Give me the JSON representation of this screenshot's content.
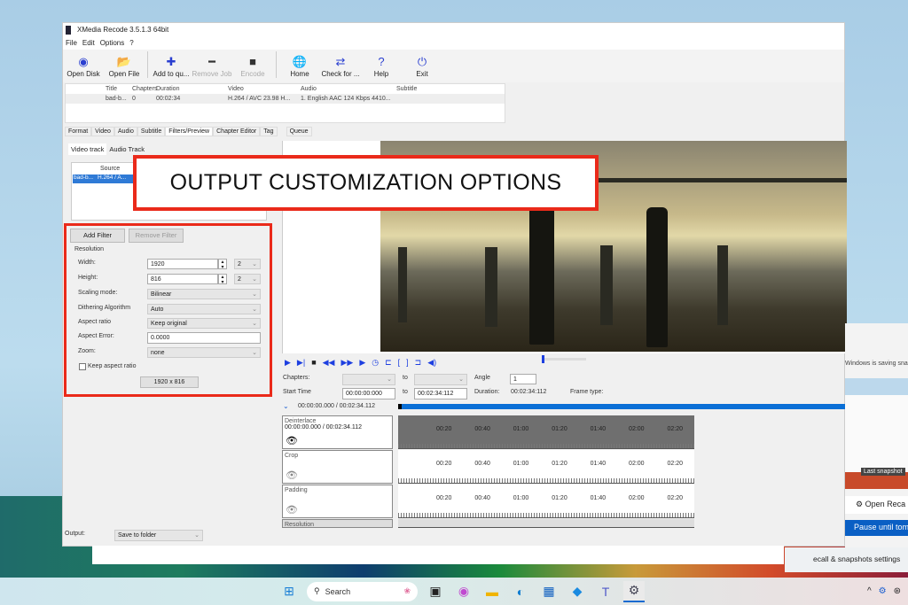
{
  "window": {
    "title": "XMedia Recode 3.5.1.3 64bit",
    "menu": [
      "File",
      "Edit",
      "Options",
      "?"
    ]
  },
  "toolbar": [
    {
      "label": "Open Disk",
      "icon": "disc-icon",
      "glyph": "◉",
      "enabled": true
    },
    {
      "label": "Open File",
      "icon": "folder-icon",
      "glyph": "📂",
      "enabled": true
    },
    {
      "label": "Add to qu...",
      "icon": "plus-icon",
      "glyph": "✚",
      "enabled": true
    },
    {
      "label": "Remove Job",
      "icon": "minus-icon",
      "glyph": "━",
      "enabled": false
    },
    {
      "label": "Encode",
      "icon": "encode-icon",
      "glyph": "■",
      "enabled": false
    },
    {
      "label": "Home",
      "icon": "globe-icon",
      "glyph": "🌐",
      "enabled": true
    },
    {
      "label": "Check for ...",
      "icon": "refresh-icon",
      "glyph": "⇄",
      "enabled": true
    },
    {
      "label": "Help",
      "icon": "help-icon",
      "glyph": "?",
      "enabled": true
    },
    {
      "label": "Exit",
      "icon": "power-icon",
      "glyph": "⏻",
      "enabled": true
    }
  ],
  "jobs": {
    "columns": [
      "Title",
      "Chapters",
      "Duration",
      "Video",
      "Audio",
      "Subtitle"
    ],
    "rows": [
      [
        "bad-b...",
        "0",
        "00:02:34",
        "H.264 / AVC  23.98 H...",
        "1. English AAC  124 Kbps 4410...",
        ""
      ]
    ]
  },
  "tabs": [
    "Format",
    "Video",
    "Audio",
    "Subtitle",
    "Filters/Preview",
    "Chapter Editor",
    "Tag",
    "Queue"
  ],
  "active_tab": "Filters/Preview",
  "subtabs": [
    "Video track",
    "Audio Track"
  ],
  "source_list": {
    "column": "Source",
    "row": [
      "bad-b...",
      "H.264 / A..."
    ]
  },
  "filter_buttons": {
    "add": "Add Filter",
    "remove": "Remove Filter"
  },
  "resolution": {
    "group": "Resolution",
    "width_label": "Width:",
    "width": "1920",
    "width_div": "2",
    "height_label": "Height:",
    "height": "816",
    "height_div": "2",
    "scaling_label": "Scaling mode:",
    "scaling": "Bilinear",
    "dither_label": "Dithering Algorithm",
    "dither": "Auto",
    "aspect_label": "Aspect ratio",
    "aspect": "Keep original",
    "aspect_error_label": "Aspect Error:",
    "aspect_error": "0.0000",
    "zoom_label": "Zoom:",
    "zoom": "none",
    "keep_aspect": "Keep aspect ratio",
    "keep_aspect_checked": false,
    "size_button": "1920 x 816"
  },
  "callout": "OUTPUT CUSTOMIZATION OPTIONS",
  "player": {
    "chapters_label": "Chapters:",
    "to": "to",
    "angle_label": "Angle",
    "angle": "1",
    "start_label": "Start Time",
    "start": "00:00:00:000",
    "end": "00:02:34:112",
    "duration_label": "Duration:",
    "duration": "00:02:34:112",
    "frame_type_label": "Frame type:",
    "position": "00:00:00.000 / 00:02:34.112"
  },
  "tracks": [
    {
      "name": "Deinterlace",
      "time": "00:00:00.000 / 00:02:34.112",
      "visible": true
    },
    {
      "name": "Crop",
      "time": "",
      "visible": false
    },
    {
      "name": "Padding",
      "time": "",
      "visible": false
    },
    {
      "name": "Resolution",
      "time": "",
      "visible": false
    }
  ],
  "ticks": [
    "00:20",
    "00:40",
    "01:00",
    "01:20",
    "01:40",
    "02:00",
    "02:20"
  ],
  "output": {
    "label": "Output:",
    "value": "Save to folder"
  },
  "flyout": {
    "saving": "Windows is saving sna",
    "last_snapshot": "Last snapshot",
    "open": "Open Reca",
    "pause": "Pause until tom",
    "settings": "ecall & snapshots settings"
  },
  "taskbar": {
    "search": "Search"
  }
}
